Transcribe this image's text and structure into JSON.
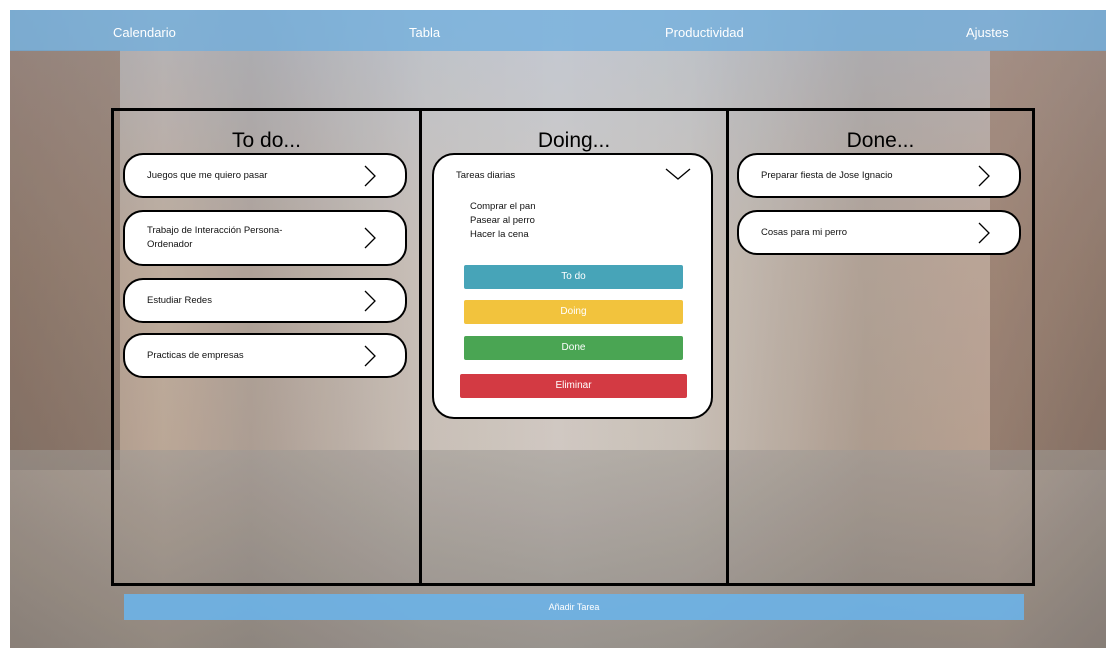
{
  "nav": {
    "calendar": "Calendario",
    "table": "Tabla",
    "productivity": "Productividad",
    "settings": "Ajustes"
  },
  "columns": {
    "todo": {
      "title": "To do...",
      "cards": [
        "Juegos que me quiero pasar",
        "Trabajo de Interacción Persona-Ordenador",
        "Estudiar Redes",
        "Practicas de empresas"
      ]
    },
    "doing": {
      "title": "Doing...",
      "open_card": {
        "title": "Tareas diarias",
        "subtasks": [
          "Comprar el pan",
          "Pasear al perro",
          "Hacer la cena"
        ],
        "buttons": {
          "todo": "To do",
          "doing": "Doing",
          "done": "Done",
          "delete": "Eliminar"
        }
      }
    },
    "done": {
      "title": "Done...",
      "cards": [
        "Preparar fiesta de Jose Ignacio",
        "Cosas para mi perro"
      ]
    }
  },
  "footer": {
    "add_task": "Añadir Tarea"
  },
  "colors": {
    "nav_bar": "#6cafe0",
    "todo_button": "#47a4b8",
    "doing_button": "#f2c33d",
    "done_button": "#4aa553",
    "delete_button": "#d33a43"
  },
  "icons": {
    "card_expand": "chevron-right-icon",
    "card_collapse": "chevron-down-icon"
  }
}
